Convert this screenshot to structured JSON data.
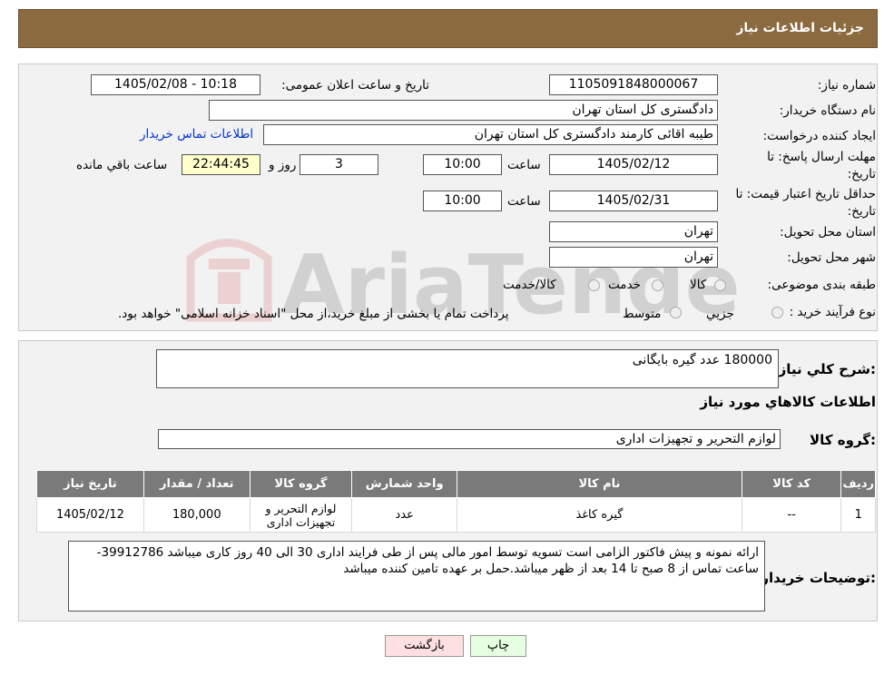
{
  "page": {
    "title": "جزئیات اطلاعات نیاز"
  },
  "info": {
    "need_number_label": "شماره نیاز:",
    "need_number": "1105091848000067",
    "announce_label": "تاریخ و ساعت اعلان عمومی:",
    "announce_value": "1405/02/08 - 10:18",
    "buyer_label": "نام دستگاه خریدار:",
    "buyer_value": "دادگستری کل استان تهران",
    "creator_label": "ایجاد کننده درخواست:",
    "creator_value": "طیبه اقائی کارمند دادگستری کل استان تهران",
    "contact_link": "اطلاعات تماس خریدار",
    "deadline_label_line1": "مهلت ارسال پاسخ: تا",
    "deadline_label_line2": "تاریخ:",
    "deadline_date": "1405/02/12",
    "time_label": "ساعت",
    "deadline_time": "10:00",
    "days_value": "3",
    "days_label": "روز و",
    "remaining_time": "22:44:45",
    "remaining_label": "ساعت باقي مانده",
    "validity_label_line1": "حداقل تاریخ اعتبار قیمت: تا",
    "validity_label_line2": "تاریخ:",
    "validity_date": "1405/02/31",
    "validity_time_label": "ساعت",
    "validity_time": "10:00",
    "province_label": "استان محل تحویل:",
    "province_value": "تهران",
    "city_label": "شهر محل تحویل:",
    "city_value": "تهران",
    "category_label": "طبقه بندی موضوعی:",
    "category_options": [
      "کالا",
      "خدمت",
      "کالا/خدمت"
    ],
    "process_label": "نوع فرآیند خرید :",
    "process_options": [
      "جزیي",
      "متوسط"
    ],
    "process_note": "پرداخت تمام یا بخشی از مبلغ خرید،از محل \"اسناد خزانه اسلامی\" خواهد بود."
  },
  "watermark": {
    "text": "AriaTender.neT"
  },
  "summary": {
    "desc_label": "شرح کلي نیاز:",
    "desc_value": "180000 عدد گیره بایگانی",
    "goods_title": "اطلاعات کالاهاي مورد نیاز",
    "group_label": "گروه کالا:",
    "group_value": "لوازم التحریر و تجهیزات اداری"
  },
  "table": {
    "headers": [
      "ردیف",
      "کد کالا",
      "نام کالا",
      "واحد شمارش",
      "گروه کالا",
      "تعداد / مقدار",
      "تاریخ نیاز"
    ],
    "rows": [
      [
        "1",
        "--",
        "گیره کاغذ",
        "عدد",
        "لوازم التحریر و تجهیزات اداری",
        "180,000",
        "1405/02/12"
      ]
    ]
  },
  "notes": {
    "label": "توضیحات خریدار:",
    "value": "ارائه نمونه و پیش فاکتور الزامی است تسویه توسط امور مالی پس از طی فرایند اداری 30 الی 40 روز کاری میباشد 39912786-ساعت تماس از 8 صبح تا 14 بعد از ظهر میباشد.حمل بر عهده تامین کننده میباشد"
  },
  "buttons": {
    "print": "چاپ",
    "back": "بازگشت"
  },
  "colors": {
    "header": "#8c6a3f",
    "back_button": "#ffe0e0",
    "print_button": "#e6ffe0",
    "table_header": "#7a7a7a"
  }
}
